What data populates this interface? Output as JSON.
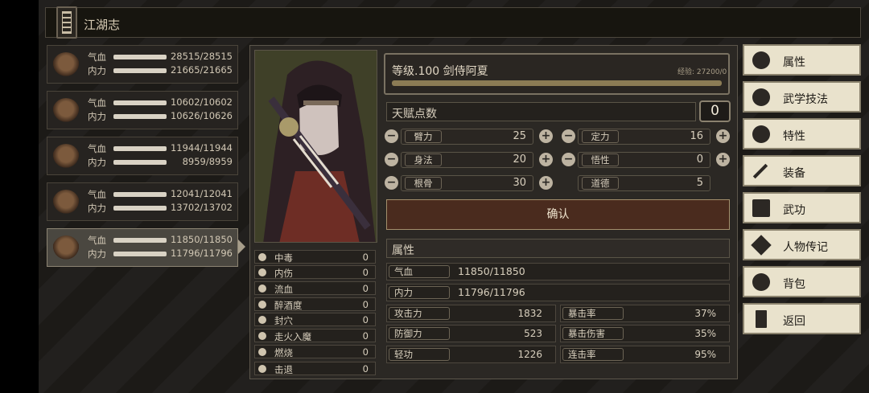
{
  "header": {
    "title": "江湖志"
  },
  "heroes": [
    {
      "hp_label": "气血",
      "hp": "28515/28515",
      "mp_label": "内力",
      "mp": "21665/21665"
    },
    {
      "hp_label": "气血",
      "hp": "10602/10602",
      "mp_label": "内力",
      "mp": "10626/10626"
    },
    {
      "hp_label": "气血",
      "hp": "11944/11944",
      "mp_label": "内力",
      "mp": "8959/8959"
    },
    {
      "hp_label": "气血",
      "hp": "12041/12041",
      "mp_label": "内力",
      "mp": "13702/13702"
    },
    {
      "hp_label": "气血",
      "hp": "11850/11850",
      "mp_label": "内力",
      "mp": "11796/11796"
    }
  ],
  "status": [
    {
      "name": "中毒",
      "value": "0"
    },
    {
      "name": "内伤",
      "value": "0"
    },
    {
      "name": "流血",
      "value": "0"
    },
    {
      "name": "醉酒度",
      "value": "0"
    },
    {
      "name": "封穴",
      "value": "0"
    },
    {
      "name": "走火入魔",
      "value": "0"
    },
    {
      "name": "燃烧",
      "value": "0"
    },
    {
      "name": "击退",
      "value": "0"
    }
  ],
  "level": {
    "text": "等级.100 剑侍阿夏",
    "exp": "经验: 27200/0"
  },
  "talent": {
    "label": "天赋点数",
    "value": "0"
  },
  "attrs": [
    {
      "name": "臂力",
      "value": "25"
    },
    {
      "name": "定力",
      "value": "16"
    },
    {
      "name": "身法",
      "value": "20"
    },
    {
      "name": "悟性",
      "value": "0"
    },
    {
      "name": "根骨",
      "value": "30"
    },
    {
      "name": "道德",
      "value": "5"
    }
  ],
  "confirm": "确认",
  "section": "属性",
  "detail": {
    "hp": {
      "name": "气血",
      "value": "11850/11850"
    },
    "mp": {
      "name": "内力",
      "value": "11796/11796"
    },
    "atk": {
      "name": "攻击力",
      "value": "1832"
    },
    "crit": {
      "name": "暴击率",
      "value": "37%"
    },
    "def": {
      "name": "防御力",
      "value": "523"
    },
    "critdmg": {
      "name": "暴击伤害",
      "value": "35%"
    },
    "qing": {
      "name": "轻功",
      "value": "1226"
    },
    "combo": {
      "name": "连击率",
      "value": "95%"
    }
  },
  "menu": [
    "属性",
    "武学技法",
    "特性",
    "装备",
    "武功",
    "人物传记",
    "背包",
    "返回"
  ]
}
